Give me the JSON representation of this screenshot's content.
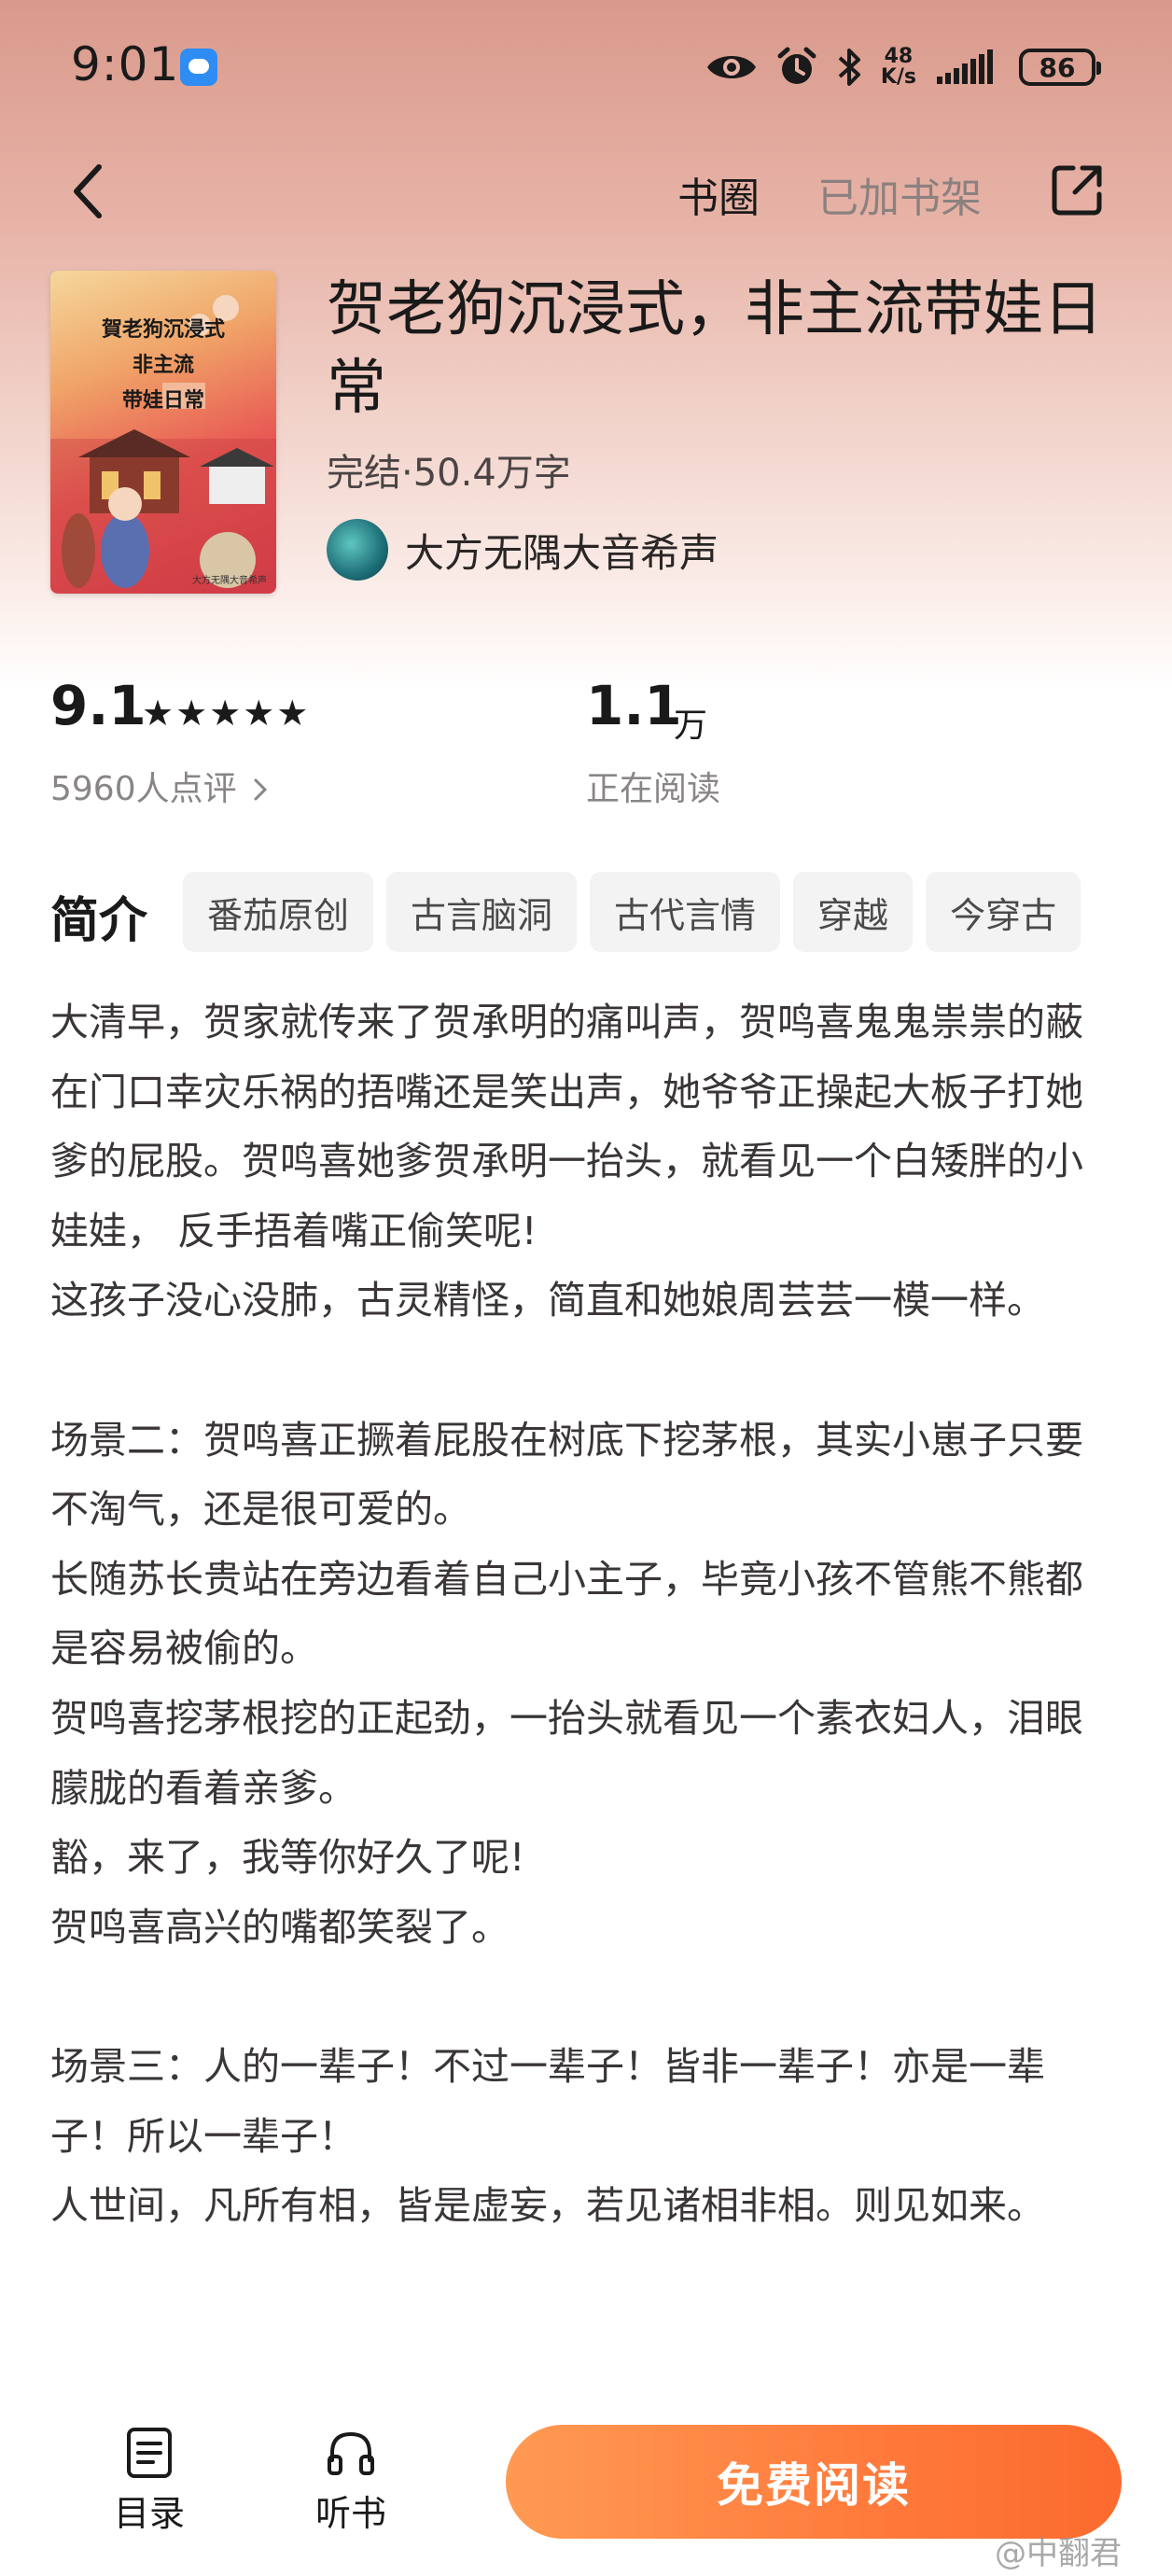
{
  "status_bar": {
    "time": "9:01",
    "net_speed_value": "48",
    "net_speed_unit": "K/s",
    "battery": "86"
  },
  "nav": {
    "quanzi": "书圈",
    "shelf": "已加书架"
  },
  "book": {
    "title": "贺老狗沉浸式，非主流带娃日常",
    "meta": "完结·50.4万字",
    "author": "大方无隅大音希声",
    "cover_title_lines": [
      "賀老狗沉浸式",
      "非主流",
      "带娃日常"
    ],
    "cover_author": "大方无隅大音希声"
  },
  "stats": {
    "rating": "9.1",
    "stars": "★★★★★",
    "rating_count": "5960人点评",
    "readers_value": "1.1",
    "readers_unit": "万",
    "readers_label": "正在阅读"
  },
  "intro": {
    "label": "简介",
    "tags": [
      "番茄原创",
      "古言脑洞",
      "古代言情",
      "穿越",
      "今穿古"
    ]
  },
  "description": [
    "大清早，贺家就传来了贺承明的痛叫声，贺鸣喜鬼鬼祟祟的蔽在门口幸灾乐祸的捂嘴还是笑出声，她爷爷正操起大板子打她爹的屁股。贺鸣喜她爹贺承明一抬头，就看见一个白矮胖的小娃娃， 反手捂着嘴正偷笑呢!",
    "这孩子没心没肺，古灵精怪，简直和她娘周芸芸一模一样。",
    "",
    "场景二：贺鸣喜正撅着屁股在树底下挖茅根，其实小崽子只要不淘气，还是很可爱的。",
    "长随苏长贵站在旁边看着自己小主子，毕竟小孩不管熊不熊都是容易被偷的。",
    "贺鸣喜挖茅根挖的正起劲，一抬头就看见一个素衣妇人，泪眼朦胧的看着亲爹。",
    "豁，来了，我等你好久了呢!",
    "贺鸣喜高兴的嘴都笑裂了。",
    "",
    "场景三：人的一辈子！不过一辈子！皆非一辈子！亦是一辈子！所以一辈子！",
    "人世间，凡所有相，皆是虚妄，若见诸相非相。则见如来。"
  ],
  "bottom_bar": {
    "catalog": "目录",
    "listen": "听书",
    "read_button": "免费阅读"
  },
  "watermark": "@中翻君",
  "colors": {
    "accent": "#ff7a3c",
    "header_gradient_top": "#d99a8c",
    "muted_text": "#8a8585"
  },
  "icons": {
    "back": "chevron-left-icon",
    "share": "share-icon",
    "catalog": "list-doc-icon",
    "listen": "headphones-icon",
    "eye": "eye-icon",
    "alarm": "alarm-icon",
    "bluetooth": "bluetooth-icon",
    "signal": "signal-icon"
  }
}
